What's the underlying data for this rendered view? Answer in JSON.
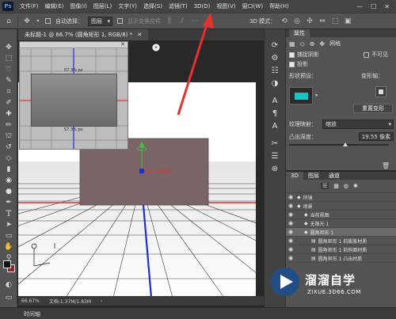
{
  "menu": {
    "logo": "Ps",
    "items": [
      "文件(F)",
      "编辑(E)",
      "图像(I)",
      "图层(L)",
      "文字(Y)",
      "选择(S)",
      "滤镜(T)",
      "3D(D)",
      "视图(V)",
      "窗口(W)",
      "帮助(H)"
    ],
    "win_min": "—",
    "win_max": "☐",
    "win_close": "✕"
  },
  "options": {
    "auto_select_label": "自动选择：",
    "auto_select_value": "图层",
    "show_transform_label": "显示变换控件",
    "mode_3d_label": "3D 模式："
  },
  "document": {
    "tab_title": "未标题-1 @ 66.7% (圆角矩形 1, RGB/8) *",
    "tab_close": "✕",
    "preview_dim_top": "57.3% px",
    "preview_dim_bottom": "57.3% px"
  },
  "status": {
    "zoom": "66.67%",
    "doc_size": "文档:1.37M/1.83M"
  },
  "timeline": {
    "label": "时间轴"
  },
  "properties": {
    "tab": "属性",
    "mesh_label": "网格",
    "catch_shadow": "捕捉阴影",
    "invisible": "不可见",
    "cast_shadow": "投影",
    "shape_preset_label": "形状预设：",
    "deform_axis_label": "变形轴：",
    "reset_deform": "重置变形",
    "texture_map_label": "纹理映射：",
    "texture_map_value": "缩放",
    "extrusion_depth_label": "凸出深度：",
    "extrusion_depth_value": "19.55 像素"
  },
  "layers": {
    "tabs": [
      "3D",
      "图层",
      "通道"
    ],
    "rows": [
      {
        "name": "环境",
        "indent": 0
      },
      {
        "name": "场景",
        "indent": 0
      },
      {
        "name": "当前视图",
        "indent": 1
      },
      {
        "name": "无限光 1",
        "indent": 1
      },
      {
        "name": "圆角矩形 1",
        "indent": 1
      },
      {
        "name": "圆角矩形 1 前膨胀材质",
        "indent": 2
      },
      {
        "name": "圆角矩形 1 前斜面材质",
        "indent": 2
      },
      {
        "name": "圆角矩形 1 凸出材质",
        "indent": 2
      }
    ]
  },
  "watermark": {
    "brand": "溜溜自学",
    "url": "ZIXUE.3D66.COM"
  },
  "colors": {
    "accent_red": "#e8302e",
    "accent_blue": "#1b2fd6",
    "accent_green": "#3cc43c",
    "watermark_blue": "#1e4e8c"
  }
}
